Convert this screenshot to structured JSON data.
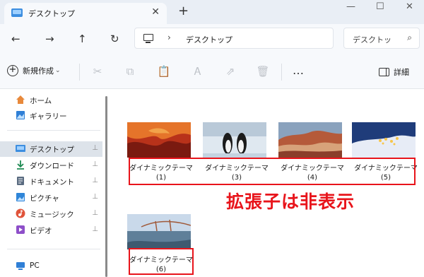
{
  "window": {
    "tab_title": "デスクトップ",
    "tab_close": "✕",
    "new_tab": "+",
    "minimize": "—",
    "maximize": "☐",
    "close": "✕"
  },
  "nav": {
    "back": "←",
    "forward": "→",
    "up": "↑",
    "refresh": "↻",
    "breadcrumb_sep": "›",
    "location": "デスクトップ"
  },
  "search": {
    "text": "デスクトッ",
    "icon": "⌕"
  },
  "commands": {
    "new_label": "新規作成",
    "new_caret": "⌄",
    "more": "…",
    "details_label": "詳細"
  },
  "sidebar": {
    "items": [
      {
        "label": "ホーム",
        "icon": "home-icon",
        "color": "#e8893b"
      },
      {
        "label": "ギャラリー",
        "icon": "gallery-icon",
        "color": "#2f7fd6"
      },
      {
        "label": "デスクトップ",
        "icon": "desktop-icon",
        "color": "#3d8ee0",
        "pinned": true
      },
      {
        "label": "ダウンロード",
        "icon": "download-icon",
        "color": "#1f8a53",
        "pinned": true
      },
      {
        "label": "ドキュメント",
        "icon": "document-icon",
        "color": "#5a6b80",
        "pinned": true
      },
      {
        "label": "ピクチャ",
        "icon": "pictures-icon",
        "color": "#2f85d8",
        "pinned": true
      },
      {
        "label": "ミュージック",
        "icon": "music-icon",
        "color": "#e0543b",
        "pinned": true
      },
      {
        "label": "ビデオ",
        "icon": "video-icon",
        "color": "#8e4fc9",
        "pinned": true
      },
      {
        "label": "PC",
        "icon": "pc-icon",
        "color": "#2f7fd6"
      }
    ],
    "pin_glyph": "⊥"
  },
  "files": [
    {
      "name": "ダイナミックテーマ",
      "num": "(1)",
      "theme": "red-canyon"
    },
    {
      "name": "ダイナミックテーマ",
      "num": "(3)",
      "theme": "penguins"
    },
    {
      "name": "ダイナミックテーマ",
      "num": "(4)",
      "theme": "painted-hills"
    },
    {
      "name": "ダイナミックテーマ",
      "num": "(5)",
      "theme": "snowy-village"
    },
    {
      "name": "ダイナミックテーマ",
      "num": "(6)",
      "theme": "bridge-coast"
    }
  ],
  "annotation": "拡張子は非表示",
  "colors": {
    "highlight_red": "#e8141b",
    "selection": "#dde3ea"
  }
}
